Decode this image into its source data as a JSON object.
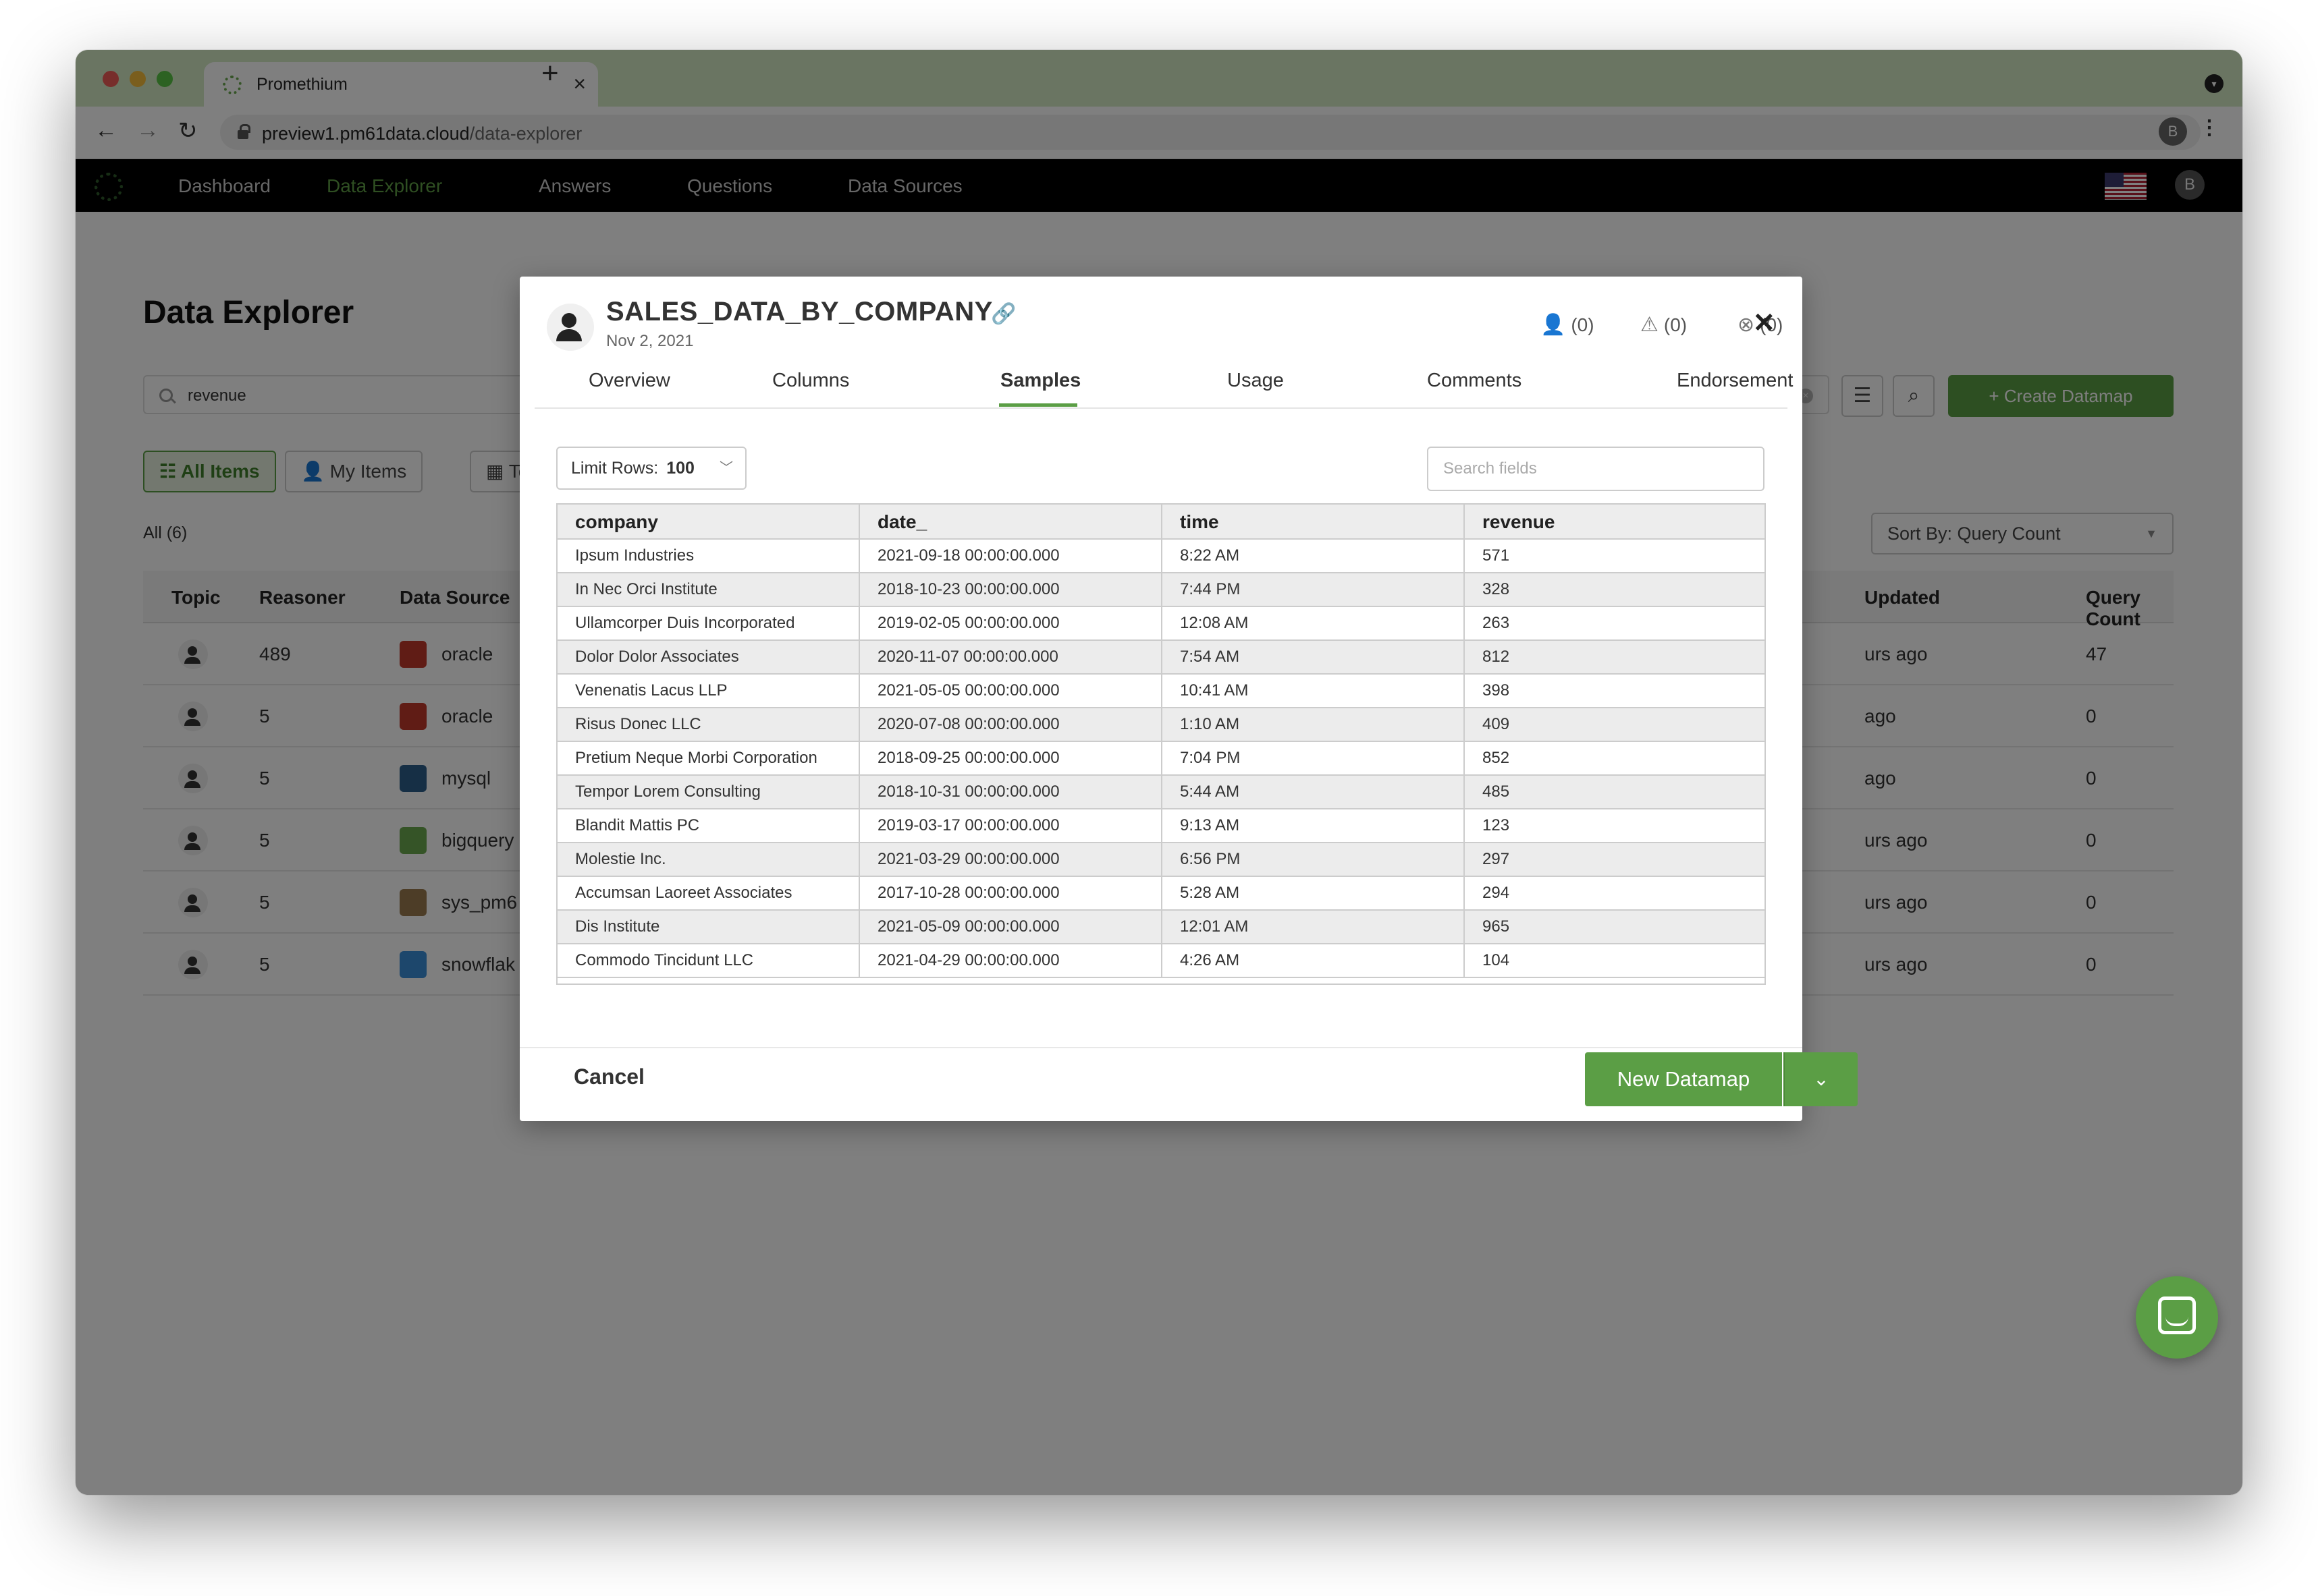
{
  "browser": {
    "tab_title": "Promethium",
    "url_host": "preview1.pm61data.cloud",
    "url_path": "/data-explorer",
    "profile_initial": "B"
  },
  "nav": {
    "items": [
      "Dashboard",
      "Data Explorer",
      "Answers",
      "Questions",
      "Data Sources"
    ],
    "active": "Data Explorer",
    "avatar_initial": "B"
  },
  "page": {
    "title": "Data Explorer",
    "search_value": "revenue",
    "create_button": "Create Datamap",
    "segments": {
      "all": "All Items",
      "mine": "My Items",
      "topics": "To"
    },
    "count_label": "All (6)",
    "sort_label": "Sort By: Query Count",
    "columns": {
      "topic": "Topic",
      "reasoner": "Reasoner",
      "data_source": "Data Source",
      "updated": "Updated",
      "query_count": "Query Count"
    },
    "rows": [
      {
        "reasoner": "489",
        "source": "oracle",
        "updated": "urs ago",
        "query_count": "47"
      },
      {
        "reasoner": "5",
        "source": "oracle",
        "updated": "ago",
        "query_count": "0"
      },
      {
        "reasoner": "5",
        "source": "mysql",
        "updated": "ago",
        "query_count": "0"
      },
      {
        "reasoner": "5",
        "source": "bigquery",
        "updated": "urs ago",
        "query_count": "0"
      },
      {
        "reasoner": "5",
        "source": "sys_pm6",
        "updated": "urs ago",
        "query_count": "0"
      },
      {
        "reasoner": "5",
        "source": "snowflak",
        "updated": "urs ago",
        "query_count": "0"
      }
    ]
  },
  "modal": {
    "title": "SALES_DATA_BY_COMPANY",
    "date": "Nov 2, 2021",
    "stats": {
      "endorse": "(0)",
      "warn": "(0)",
      "deprecate": "(0)"
    },
    "tabs": [
      "Overview",
      "Columns",
      "Samples",
      "Usage",
      "Comments",
      "Endorsement"
    ],
    "active_tab": "Samples",
    "limit_label": "Limit Rows:",
    "limit_value": "100",
    "search_placeholder": "Search fields",
    "columns": [
      "company",
      "date_",
      "time",
      "revenue"
    ],
    "rows": [
      [
        "Ipsum Industries",
        "2021-09-18 00:00:00.000",
        "8:22 AM",
        "571"
      ],
      [
        "In Nec Orci Institute",
        "2018-10-23 00:00:00.000",
        "7:44 PM",
        "328"
      ],
      [
        "Ullamcorper Duis Incorporated",
        "2019-02-05 00:00:00.000",
        "12:08 AM",
        "263"
      ],
      [
        "Dolor Dolor Associates",
        "2020-11-07 00:00:00.000",
        "7:54 AM",
        "812"
      ],
      [
        "Venenatis Lacus LLP",
        "2021-05-05 00:00:00.000",
        "10:41 AM",
        "398"
      ],
      [
        "Risus Donec LLC",
        "2020-07-08 00:00:00.000",
        "1:10 AM",
        "409"
      ],
      [
        "Pretium Neque Morbi Corporation",
        "2018-09-25 00:00:00.000",
        "7:04 PM",
        "852"
      ],
      [
        "Tempor Lorem Consulting",
        "2018-10-31 00:00:00.000",
        "5:44 AM",
        "485"
      ],
      [
        "Blandit Mattis PC",
        "2019-03-17 00:00:00.000",
        "9:13 AM",
        "123"
      ],
      [
        "Molestie Inc.",
        "2021-03-29 00:00:00.000",
        "6:56 PM",
        "297"
      ],
      [
        "Accumsan Laoreet Associates",
        "2017-10-28 00:00:00.000",
        "5:28 AM",
        "294"
      ],
      [
        "Dis Institute",
        "2021-05-09 00:00:00.000",
        "12:01 AM",
        "965"
      ],
      [
        "Commodo Tincidunt LLC",
        "2021-04-29 00:00:00.000",
        "4:26 AM",
        "104"
      ]
    ],
    "cancel": "Cancel",
    "primary": "New Datamap"
  },
  "icons": {
    "source_colors": [
      "#c0392b",
      "#c0392b",
      "#2c5f8a",
      "#6aa84f",
      "#9a7b4f",
      "#3a8fd9"
    ]
  }
}
